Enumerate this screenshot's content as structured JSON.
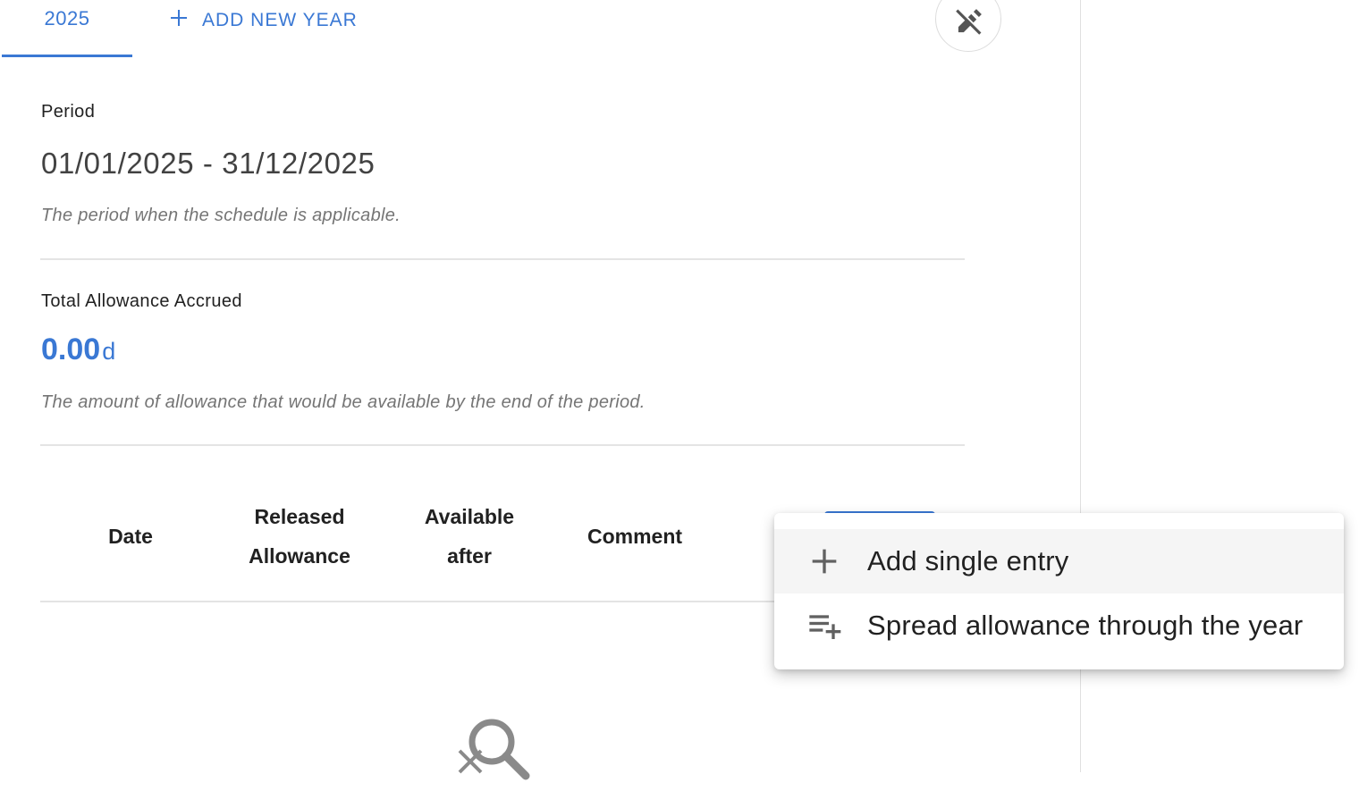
{
  "tabs": {
    "year_label": "2025",
    "add_label": "ADD NEW YEAR"
  },
  "toolbar": {
    "tool_icon": "pencil-off-icon"
  },
  "period": {
    "label": "Period",
    "value": "01/01/2025 - 31/12/2025",
    "hint": "The period when the schedule is applicable."
  },
  "allowance": {
    "label": "Total Allowance Accrued",
    "value": "0.00",
    "unit": "d",
    "hint": "The amount of allowance that would be available by the end of the period."
  },
  "table": {
    "headers": [
      {
        "line1": "Date",
        "line2": ""
      },
      {
        "line1": "Released",
        "line2": "Allowance"
      },
      {
        "line1": "Available",
        "line2": "after"
      },
      {
        "line1": "Comment",
        "line2": ""
      }
    ],
    "empty_icon": "search-off-icon"
  },
  "menu": {
    "items": [
      {
        "icon": "plus-icon",
        "label": "Add single entry"
      },
      {
        "icon": "playlist-add-icon",
        "label": "Spread allowance through the year"
      }
    ]
  },
  "colors": {
    "accent": "#3a78d4",
    "text": "#212121",
    "muted": "#757575"
  }
}
